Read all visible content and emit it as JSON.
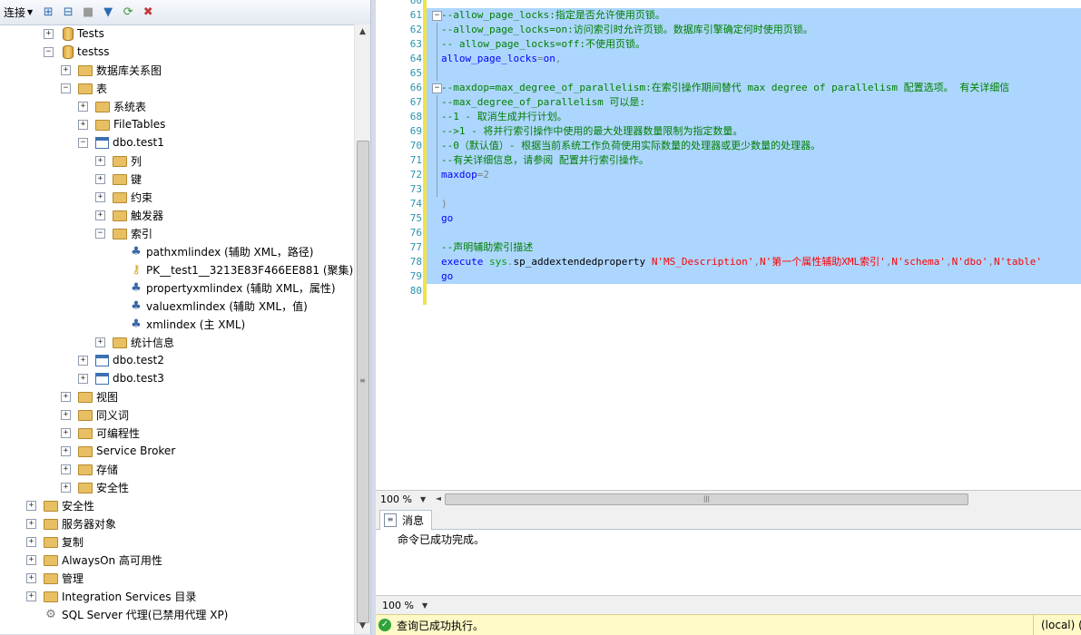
{
  "toolbar": {
    "connect_label": "连接",
    "icons": [
      "connect-object-explorer-icon",
      "disconnect-icon",
      "stop-icon",
      "filter-icon",
      "refresh-icon",
      "delete-icon"
    ]
  },
  "tree": {
    "tests": "Tests",
    "testss": "testss",
    "db_diagrams": "数据库关系图",
    "tables": "表",
    "system_tables": "系统表",
    "filetables": "FileTables",
    "test1": "dbo.test1",
    "columns": "列",
    "keys": "键",
    "constraints": "约束",
    "triggers": "触发器",
    "indexes": "索引",
    "idx_path": "pathxmlindex (辅助 XML，路径)",
    "idx_pk": "PK__test1__3213E83F466EE881 (聚集)",
    "idx_property": "propertyxmlindex (辅助 XML，属性)",
    "idx_value": "valuexmlindex (辅助 XML，值)",
    "idx_xml": "xmlindex (主 XML)",
    "statistics": "统计信息",
    "test2": "dbo.test2",
    "test3": "dbo.test3",
    "views": "视图",
    "synonyms": "同义词",
    "programmability": "可编程性",
    "service_broker": "Service Broker",
    "storage": "存储",
    "db_security": "安全性",
    "security": "安全性",
    "server_objects": "服务器对象",
    "replication": "复制",
    "alwayson": "AlwaysOn 高可用性",
    "management": "管理",
    "integration_services": "Integration Services 目录",
    "agent": "SQL Server 代理(已禁用代理 XP)"
  },
  "editor": {
    "line_numbers": [
      "60",
      "61",
      "62",
      "63",
      "64",
      "65",
      "66",
      "67",
      "68",
      "69",
      "70",
      "71",
      "72",
      "73",
      "74",
      "75",
      "76",
      "77",
      "78",
      "79",
      "80"
    ],
    "lines": [
      "",
      "--allow_page_locks:指定是否允许使用页锁。",
      "--allow_page_locks=on:访问索引时允许页锁。数据库引擎确定何时使用页锁。",
      "-- allow_page_locks=off:不使用页锁。",
      "allow_page_locks=on,",
      "",
      "--maxdop=max_degree_of_parallelism:在索引操作期间替代 max degree of parallelism 配置选项。 有关详细信",
      "--max_degree_of_parallelism 可以是:",
      "--1 - 取消生成并行计划。",
      "-->1 - 将并行索引操作中使用的最大处理器数量限制为指定数量。",
      "--0（默认值）- 根据当前系统工作负荷使用实际数量的处理器或更少数量的处理器。",
      "--有关详细信息，请参阅 配置并行索引操作。",
      "maxdop=2",
      "",
      ")",
      "go",
      "",
      "--声明辅助索引描述",
      "",
      "go",
      ""
    ],
    "line78": {
      "kw": "execute ",
      "sys": "sys",
      "dot": ".",
      "proc": "sp_addextendedproperty ",
      "s1": "N'MS_Description'",
      "c1": ",",
      "s2": "N'第一个属性辅助XML索引'",
      "c2": ",",
      "s3": "N'schema'",
      "c3": ",",
      "s4": "N'dbo'",
      "c4": ",",
      "s5": "N'table'"
    },
    "line72_key": "maxdop",
    "line72_op": "=2",
    "line64_key": "allow_page_locks",
    "line64_op": "=",
    "line64_val": "on",
    "line64_comma": ","
  },
  "editor_zoom": "100 %",
  "results": {
    "tab_label": "消息",
    "message": "命令已成功完成。",
    "zoom": "100 %"
  },
  "status": {
    "text": "查询已成功执行。",
    "server": "(local) (1"
  }
}
